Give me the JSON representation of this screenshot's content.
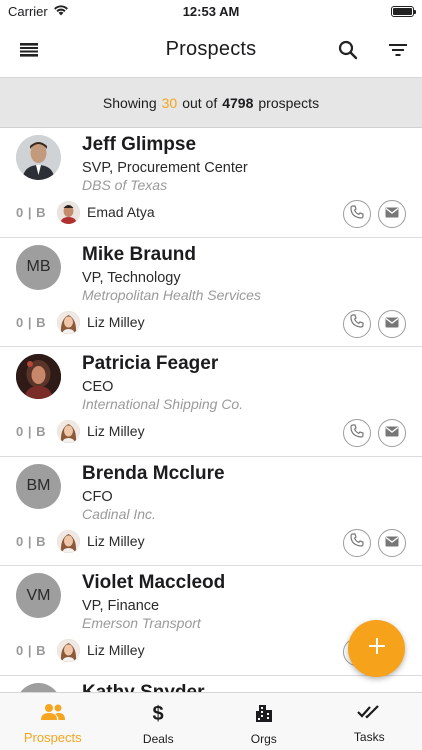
{
  "status_bar": {
    "carrier": "Carrier",
    "time": "12:53 AM"
  },
  "nav": {
    "title": "Prospects",
    "menu_icon": "list-icon",
    "search_icon": "search-icon",
    "filter_icon": "filter-icon"
  },
  "summary": {
    "prefix": "Showing",
    "shown": "30",
    "middle": "out of",
    "total": "4798",
    "suffix": "prospects"
  },
  "prospects": [
    {
      "name": "Jeff Glimpse",
      "title": "SVP, Procurement Center",
      "org": "DBS of Texas",
      "initials": "",
      "photo": true,
      "score": "0 | B",
      "owner": "Emad Atya"
    },
    {
      "name": "Mike Braund",
      "title": "VP, Technology",
      "org": "Metropolitan Health Services",
      "initials": "MB",
      "photo": false,
      "score": "0 | B",
      "owner": "Liz Milley"
    },
    {
      "name": "Patricia Feager",
      "title": "CEO",
      "org": "International Shipping Co.",
      "initials": "",
      "photo": true,
      "score": "0 | B",
      "owner": "Liz Milley"
    },
    {
      "name": "Brenda Mcclure",
      "title": "CFO",
      "org": "Cadinal Inc.",
      "initials": "BM",
      "photo": false,
      "score": "0 | B",
      "owner": "Liz Milley"
    },
    {
      "name": "Violet Maccleod",
      "title": "VP, Finance",
      "org": "Emerson Transport",
      "initials": "VM",
      "photo": false,
      "score": "0 | B",
      "owner": "Liz Milley"
    },
    {
      "name": "Kathy Snyder",
      "title": "",
      "org": "",
      "initials": "",
      "photo": false,
      "score": "",
      "owner": ""
    }
  ],
  "fab": {
    "icon": "plus-icon"
  },
  "tabs": [
    {
      "label": "Prospects",
      "icon": "people-icon",
      "active": true
    },
    {
      "label": "Deals",
      "icon": "dollar-icon",
      "active": false
    },
    {
      "label": "Orgs",
      "icon": "building-icon",
      "active": false
    },
    {
      "label": "Tasks",
      "icon": "checkmarks-icon",
      "active": false
    }
  ],
  "colors": {
    "accent": "#f5a51f",
    "avatar_bg": "#9e9e9e",
    "summary_bg": "#e6e6e6"
  }
}
